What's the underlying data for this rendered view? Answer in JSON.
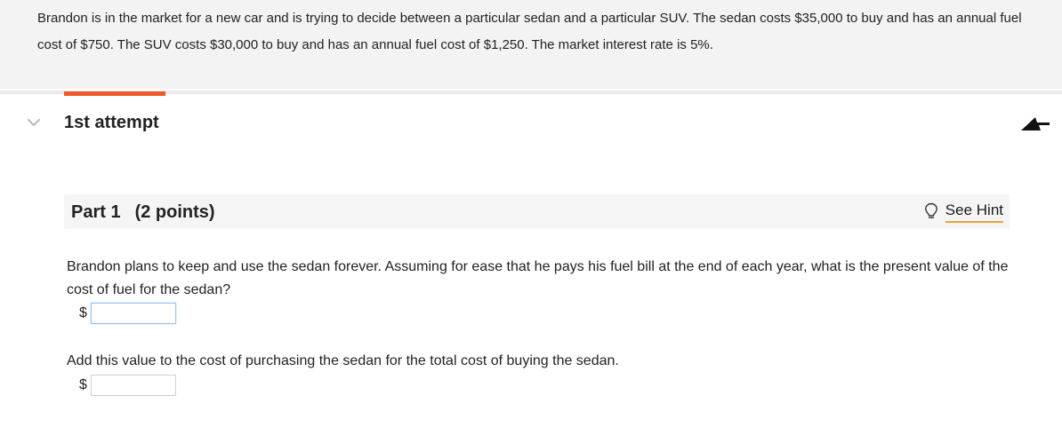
{
  "question": {
    "text": "Brandon is in the market for a new car and is trying to decide between a particular sedan and a particular SUV. The sedan costs $35,000 to buy and has an annual fuel cost of $750. The SUV costs $30,000 to buy and has an annual fuel cost of $1,250. The market interest rate is 5%."
  },
  "attempt": {
    "title": "1st attempt",
    "chevron_icon": "chevron-down-icon",
    "collapse_icon": "arrow-up-left-icon"
  },
  "part": {
    "label": "Part 1",
    "points": "(2 points)",
    "hint_label": "See Hint",
    "hint_icon": "lightbulb-icon"
  },
  "questions": [
    {
      "prompt": "Brandon plans to keep and use the sedan forever. Assuming for ease that he pays his fuel bill at the end of each year, what is the present value of the cost of fuel for the sedan?",
      "currency": "$",
      "value": ""
    },
    {
      "prompt": "Add this value to the cost of purchasing the sedan for the total cost of buying the sedan.",
      "currency": "$",
      "value": ""
    }
  ],
  "colors": {
    "accent": "#f05a28",
    "hint_underline": "#e8a23a",
    "focus_border": "#9cc3ec"
  }
}
